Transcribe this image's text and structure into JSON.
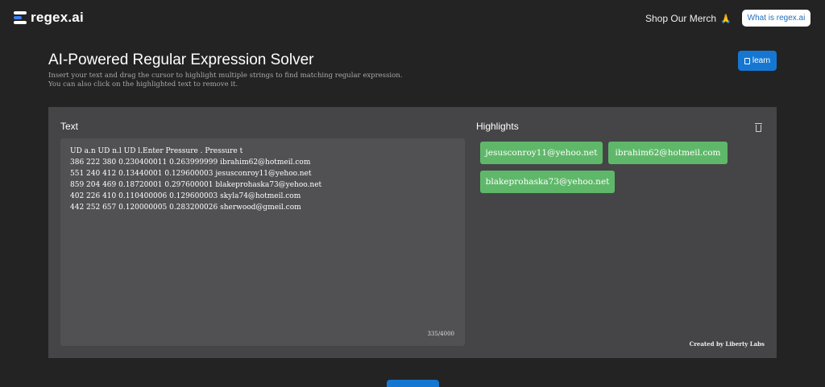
{
  "header": {
    "logo_text": "regex.ai",
    "merch_label": "Shop Our Merch",
    "merch_emoji": "🙏",
    "what_is_label": "What is regex.ai"
  },
  "intro": {
    "title": "AI-Powered Regular Expression Solver",
    "line1": "Insert your text and drag the cursor to highlight multiple strings to find matching regular expression.",
    "line2": "You can also click on the highlighted text to remove it.",
    "learn_label": "learn"
  },
  "text_panel": {
    "label": "Text",
    "lines": [
      "UD a.n UD n.l UD l.Enter Pressure . Pressure t",
      "386 222 380 0.230400011 0.263999999 ibrahim62@hotmeil.com",
      "551 240 412 0.13440001 0.129600003 jesusconroy11@yehoo.net",
      "859 204 469 0.18720001 0.297600001 blakeprohaska73@yehoo.net",
      "402 226 410 0.110400006 0.129600003 skyla74@hotmeil.com",
      "442 252 657 0.120000005 0.283200026 sherwood@gmeil.com"
    ],
    "char_count": "335/4000"
  },
  "highlights": {
    "label": "Highlights",
    "items": [
      "jesusconroy11@yehoo.net",
      "ibrahim62@hotmeil.com",
      "blakeprohaska73@yehoo.net"
    ]
  },
  "credit": "Created by Liberty Labs",
  "colors": {
    "background": "#232323",
    "panel": "#454547",
    "accent": "#1677d2",
    "highlight_chip": "#5fb86a"
  },
  "icons": [
    "regex-logo-icon",
    "book-icon",
    "trash-icon"
  ]
}
